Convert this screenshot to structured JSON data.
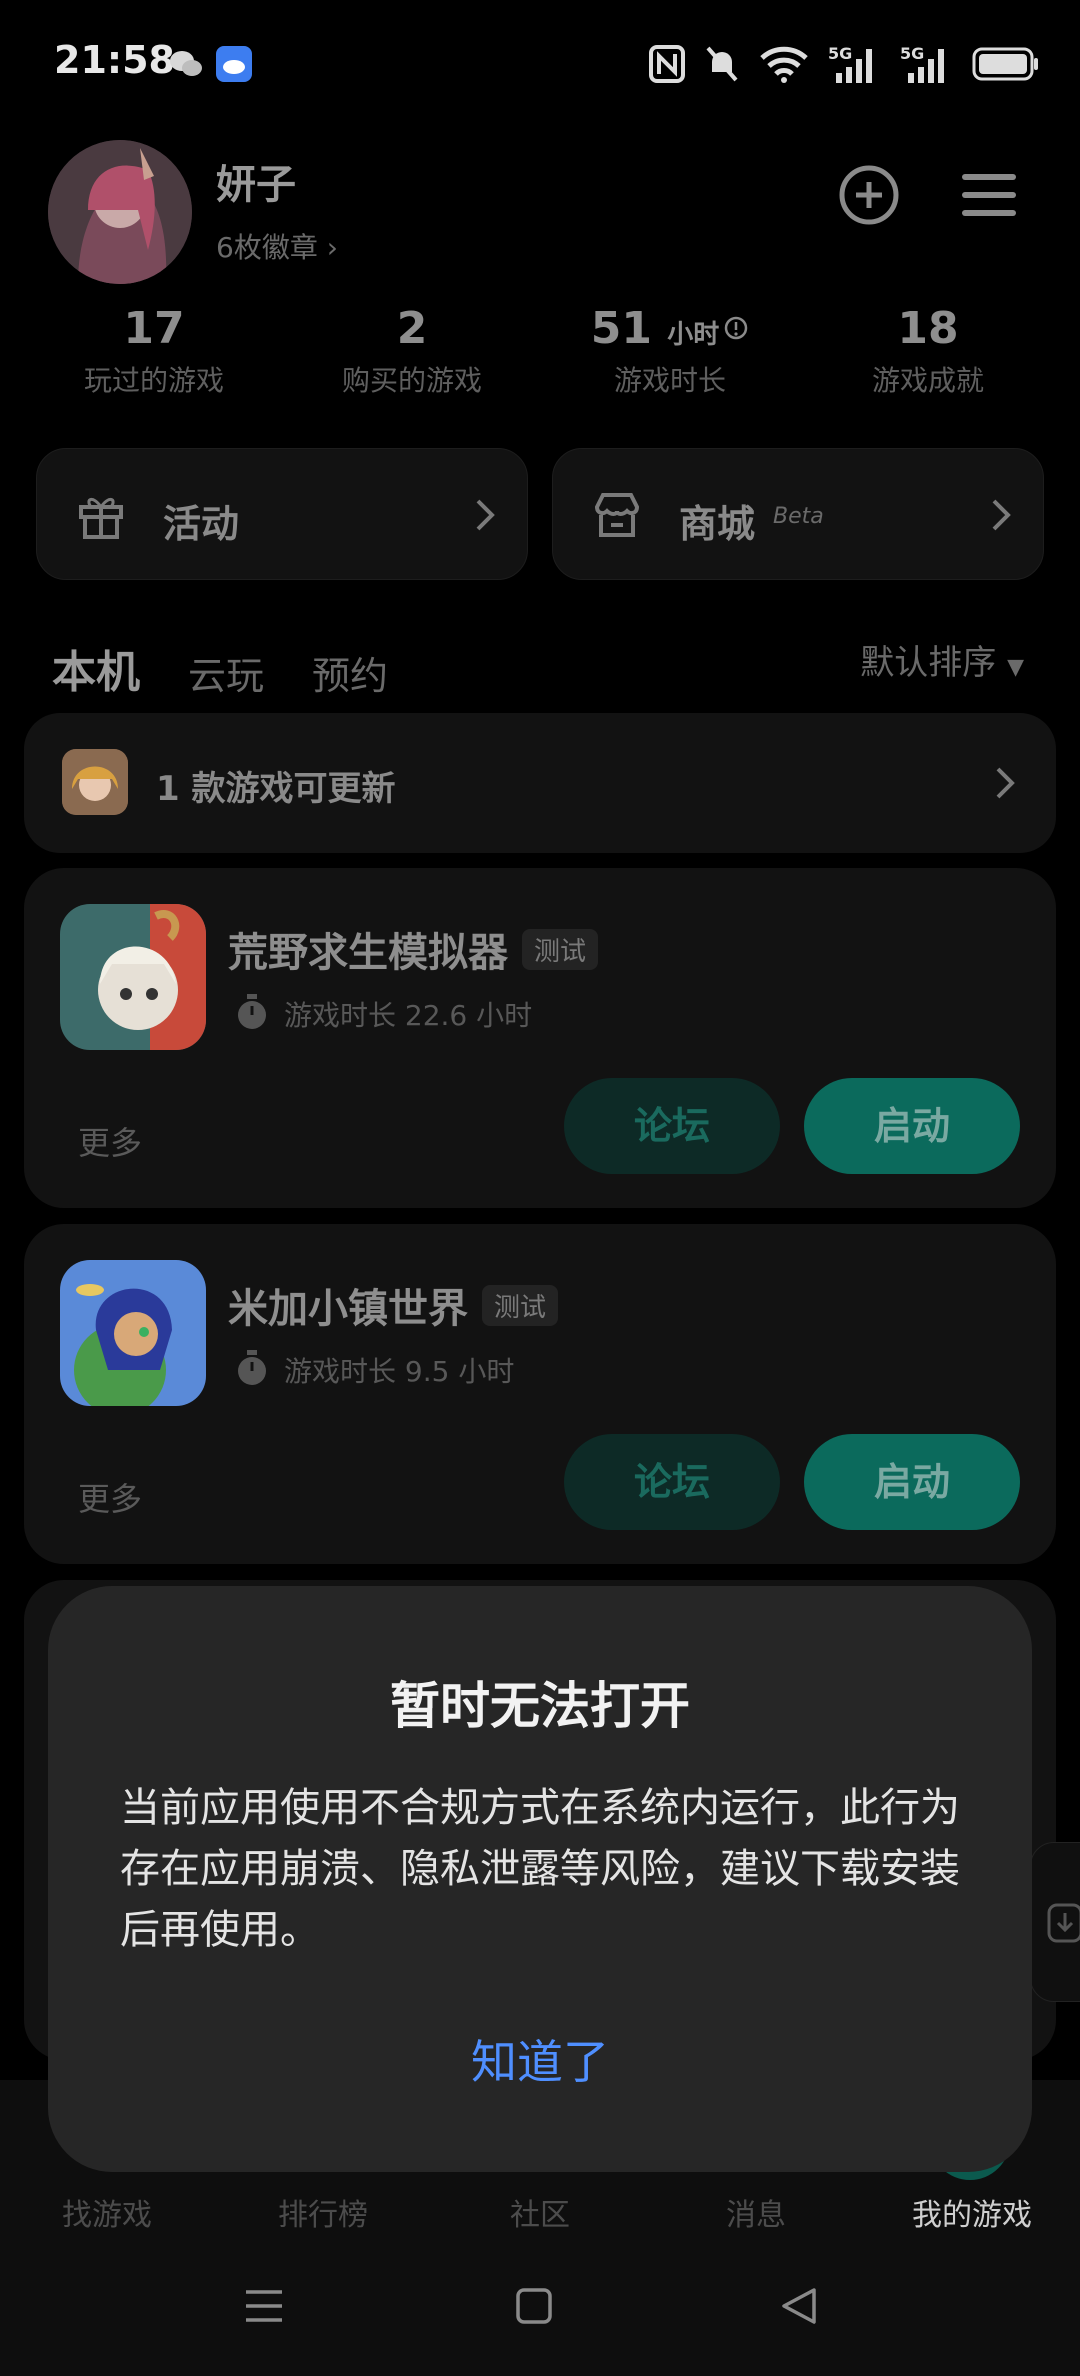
{
  "status_bar": {
    "time": "21:58",
    "icons": [
      "wechat-icon",
      "weather-app-icon",
      "nfc-icon",
      "mute-bell-icon",
      "wifi-icon",
      "5g-signal-icon",
      "5g-signal-icon",
      "battery-icon"
    ]
  },
  "profile": {
    "username": "妍子",
    "badges": "6枚徽章",
    "actions": [
      "add-icon",
      "menu-icon"
    ]
  },
  "stats": [
    {
      "value": "17",
      "unit": "",
      "label": "玩过的游戏"
    },
    {
      "value": "2",
      "unit": "",
      "label": "购买的游戏"
    },
    {
      "value": "51",
      "unit": "小时",
      "label": "游戏时长"
    },
    {
      "value": "18",
      "unit": "",
      "label": "游戏成就"
    }
  ],
  "shortcuts": {
    "activity": "活动",
    "store": "商城",
    "store_badge": "Beta"
  },
  "tabs": {
    "items": [
      "本机",
      "云玩",
      "预约"
    ],
    "active": "本机",
    "sort": "默认排序"
  },
  "update_banner": {
    "text": "1 款游戏可更新"
  },
  "games": [
    {
      "name": "荒野求生模拟器",
      "tag": "测试",
      "playtime": "游戏时长 22.6 小时",
      "more": "更多",
      "forum": "论坛",
      "launch": "启动"
    },
    {
      "name": "米加小镇世界",
      "tag": "测试",
      "playtime": "游戏时长 9.5 小时",
      "more": "更多",
      "forum": "论坛",
      "launch": "启动"
    }
  ],
  "bottom_nav": {
    "items": [
      "找游戏",
      "排行榜",
      "社区",
      "消息",
      "我的游戏"
    ],
    "active": "我的游戏"
  },
  "dialog": {
    "title": "暂时无法打开",
    "message": "当前应用使用不合规方式在系统内运行，此行为存在应用崩溃、隐私泄露等风险，建议下载安装后再使用。",
    "confirm": "知道了"
  },
  "colors": {
    "accent_green": "#0b6a5c",
    "dialog_bg": "#262626",
    "confirm_blue": "#4f8fff"
  }
}
